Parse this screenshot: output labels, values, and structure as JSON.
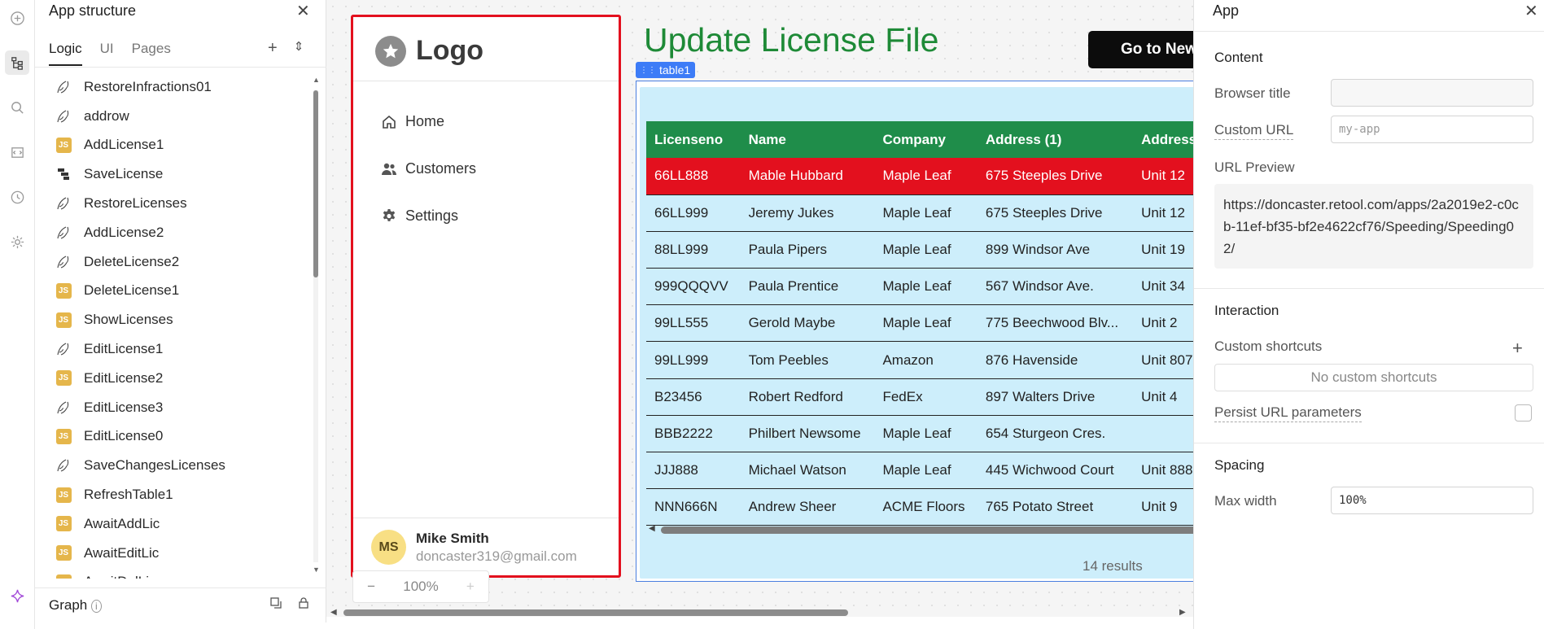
{
  "left_panel": {
    "title": "App structure",
    "tabs": [
      {
        "label": "Logic",
        "active": true
      },
      {
        "label": "UI",
        "active": false
      },
      {
        "label": "Pages",
        "active": false
      }
    ],
    "items": [
      {
        "name": "RestoreInfractions01",
        "icon": "query-icon"
      },
      {
        "name": "addrow",
        "icon": "query-icon"
      },
      {
        "name": "AddLicense1",
        "icon": "js-icon"
      },
      {
        "name": "SaveLicense",
        "icon": "workflow-icon"
      },
      {
        "name": "RestoreLicenses",
        "icon": "query-icon"
      },
      {
        "name": "AddLicense2",
        "icon": "query-icon"
      },
      {
        "name": "DeleteLicense2",
        "icon": "query-icon"
      },
      {
        "name": "DeleteLicense1",
        "icon": "js-icon"
      },
      {
        "name": "ShowLicenses",
        "icon": "js-icon"
      },
      {
        "name": "EditLicense1",
        "icon": "query-icon"
      },
      {
        "name": "EditLicense2",
        "icon": "js-icon"
      },
      {
        "name": "EditLicense3",
        "icon": "query-icon"
      },
      {
        "name": "EditLicense0",
        "icon": "js-icon"
      },
      {
        "name": "SaveChangesLicenses",
        "icon": "query-icon"
      },
      {
        "name": "RefreshTable1",
        "icon": "js-icon"
      },
      {
        "name": "AwaitAddLic",
        "icon": "js-icon"
      },
      {
        "name": "AwaitEditLic",
        "icon": "js-icon"
      },
      {
        "name": "AwaitDelLic",
        "icon": "js-icon"
      }
    ],
    "footer_title": "Graph",
    "js_badge": "JS"
  },
  "canvas": {
    "sidebar": {
      "logo_text": "Logo",
      "nav": [
        {
          "label": "Home",
          "icon": "home-icon"
        },
        {
          "label": "Customers",
          "icon": "users-icon"
        },
        {
          "label": "Settings",
          "icon": "gear-icon"
        }
      ],
      "user": {
        "initials": "MS",
        "name": "Mike Smith",
        "email": "doncaster319@gmail.com"
      }
    },
    "heading": "Update License File",
    "go_button": "Go to New",
    "table": {
      "tag": "table1",
      "columns": [
        "Licenseno",
        "Name",
        "Company",
        "Address (1)",
        "Address"
      ],
      "rows": [
        [
          "66LL888",
          "Mable Hubbard",
          "Maple Leaf",
          "675 Steeples Drive",
          "Unit 12"
        ],
        [
          "66LL999",
          "Jeremy Jukes",
          "Maple Leaf",
          "675 Steeples Drive",
          "Unit 12"
        ],
        [
          "88LL999",
          "Paula Pipers",
          "Maple Leaf",
          "899 Windsor Ave",
          "Unit 19"
        ],
        [
          "999QQQVV",
          "Paula Prentice",
          "Maple Leaf",
          "567 Windsor Ave.",
          "Unit 34"
        ],
        [
          "99LL555",
          "Gerold Maybe",
          "Maple Leaf",
          "775 Beechwood Blv...",
          "Unit 2"
        ],
        [
          "99LL999",
          "Tom Peebles",
          "Amazon",
          "876 Havenside",
          "Unit 807"
        ],
        [
          "B23456",
          "Robert Redford",
          "FedEx",
          "897 Walters Drive",
          "Unit 4"
        ],
        [
          "BBB2222",
          "Philbert Newsome",
          "Maple Leaf",
          "654 Sturgeon Cres.",
          ""
        ],
        [
          "JJJ888",
          "Michael Watson",
          "Maple Leaf",
          "445 Wichwood Court",
          "Unit 888"
        ],
        [
          "NNN666N",
          "Andrew Sheer",
          "ACME Floors",
          "765 Potato Street",
          "Unit 9"
        ]
      ],
      "selected_row": 0,
      "footer": "14 results"
    },
    "zoom": {
      "minus": "−",
      "value": "100%",
      "plus": "+"
    }
  },
  "right_panel": {
    "title": "App",
    "content_section": "Content",
    "browser_title_label": "Browser title",
    "browser_title_value": "",
    "custom_url_label": "Custom URL",
    "custom_url_placeholder": "my-app",
    "url_preview_label": "URL Preview",
    "url_preview": "https://doncaster.retool.com/apps/2a2019e2-c0cb-11ef-bf35-bf2e4622cf76/Speeding/Speeding02/",
    "interaction_section": "Interaction",
    "custom_shortcuts_label": "Custom shortcuts",
    "no_shortcuts": "No custom shortcuts",
    "persist_label": "Persist URL parameters",
    "spacing_section": "Spacing",
    "max_width_label": "Max width",
    "max_width_value": "100%"
  },
  "colors": {
    "accent_red": "#e3101e",
    "heading_green": "#1e8a37",
    "table_header": "#1f8d4a",
    "table_bg": "#cdeefb",
    "selection_blue": "#3d7cf7"
  }
}
